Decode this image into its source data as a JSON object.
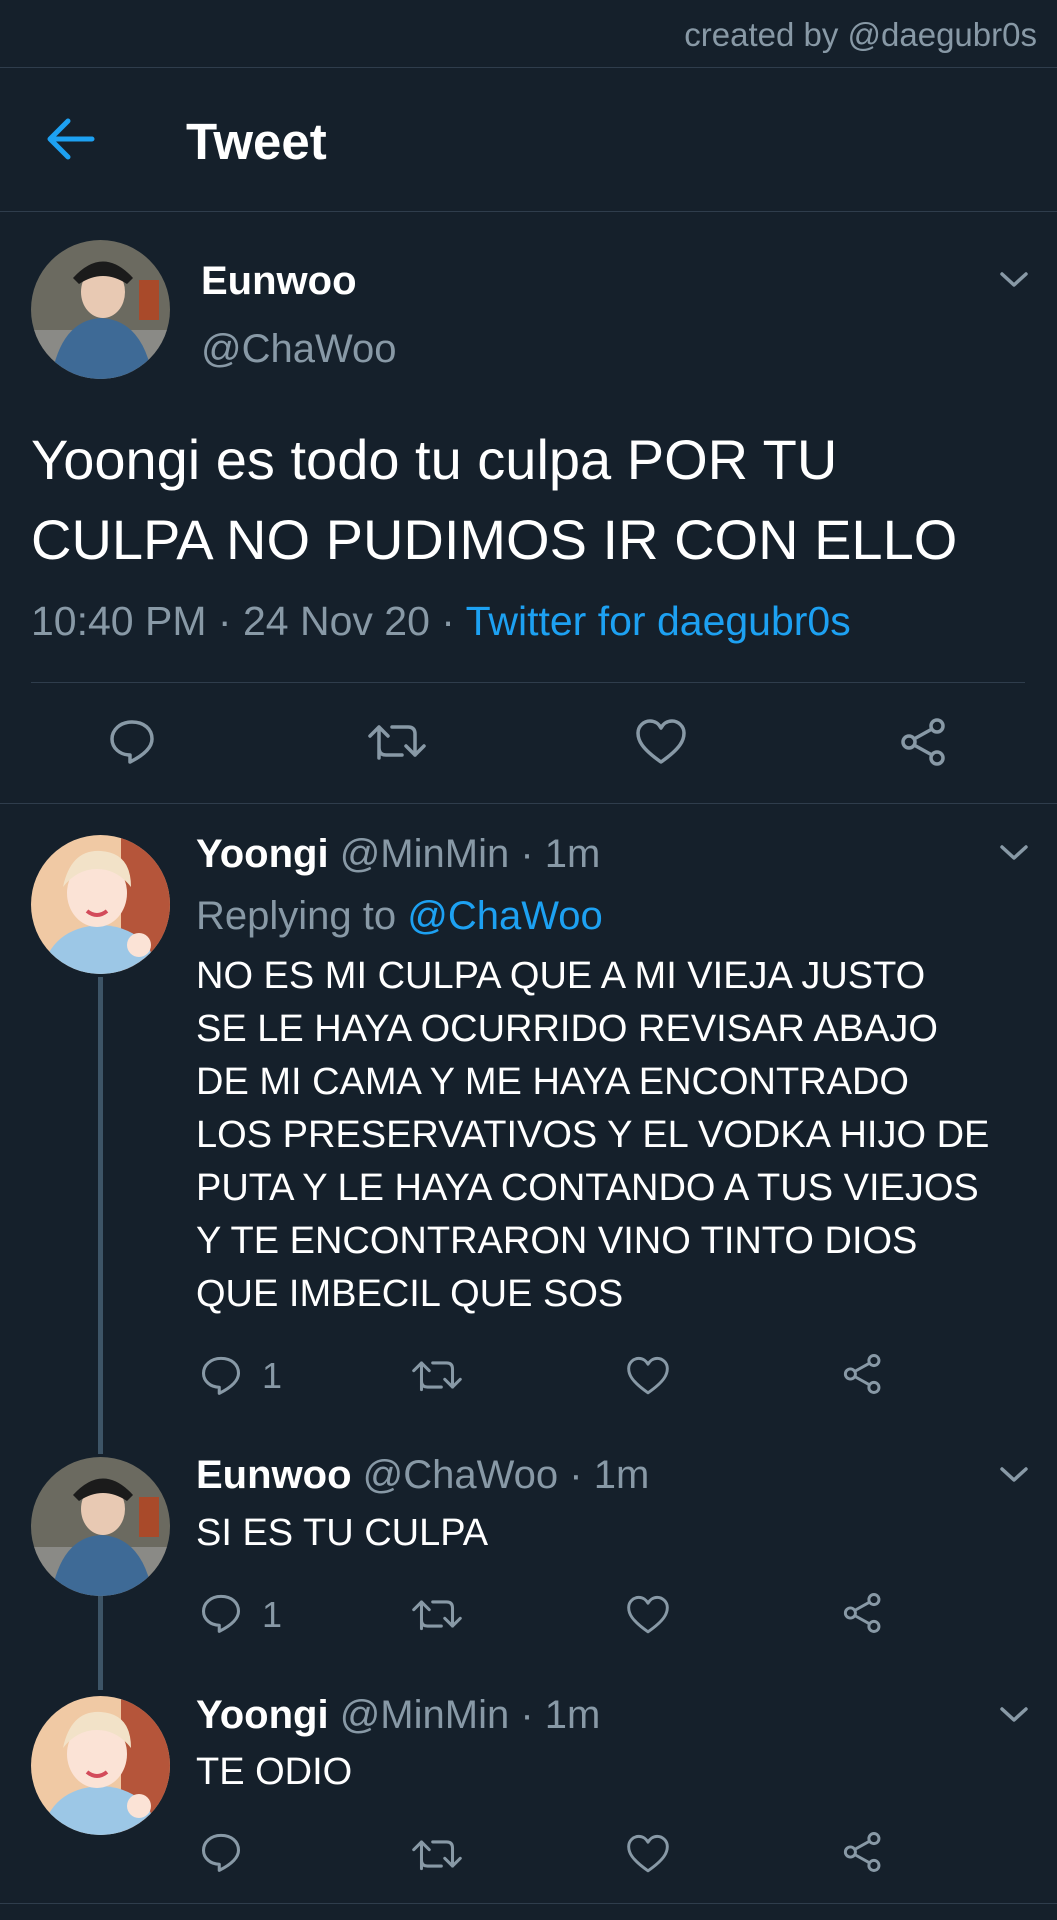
{
  "credit": "created by @daegubr0s",
  "header": {
    "title": "Tweet",
    "back_icon": "arrow-left-icon"
  },
  "colors": {
    "background": "#15202b",
    "accent": "#1da1f2",
    "muted": "#8899a6",
    "divider": "#2f3d4c"
  },
  "main_tweet": {
    "name": "Eunwoo",
    "handle": "@ChaWoo",
    "text": "Yoongi es todo tu culpa POR TU CULPA NO PUDIMOS IR CON ELLO",
    "time": "10:40 PM",
    "sep1": "·",
    "date": "24 Nov 20",
    "sep2": "·",
    "source": "Twitter for daegubr0s",
    "actions": [
      "reply-icon",
      "retweet-icon",
      "like-icon",
      "share-icon"
    ]
  },
  "replies": [
    {
      "name": "Yoongi",
      "handle": "@MinMin",
      "time": "· 1m",
      "replying_prefix": "Replying to",
      "replying_to": "@ChaWoo",
      "lines": [
        "NO ES MI CULPA QUE A MI VIEJA JUSTO",
        "SE LE HAYA OCURRIDO REVISAR ABAJO",
        "DE MI CAMA Y ME HAYA ENCONTRADO",
        "LOS PRESERVATIVOS Y EL VODKA HIJO DE",
        "PUTA Y LE HAYA CONTANDO A TUS VIEJOS",
        "Y TE ENCONTRARON VINO TINTO DIOS",
        "QUE IMBECIL QUE SOS"
      ],
      "reply_count": "1"
    },
    {
      "name": "Eunwoo",
      "handle": "@ChaWoo",
      "time": "· 1m",
      "text": "SI ES TU CULPA",
      "reply_count": "1"
    },
    {
      "name": "Yoongi",
      "handle": "@MinMin",
      "time": "· 1m",
      "text": "TE ODIO"
    }
  ]
}
